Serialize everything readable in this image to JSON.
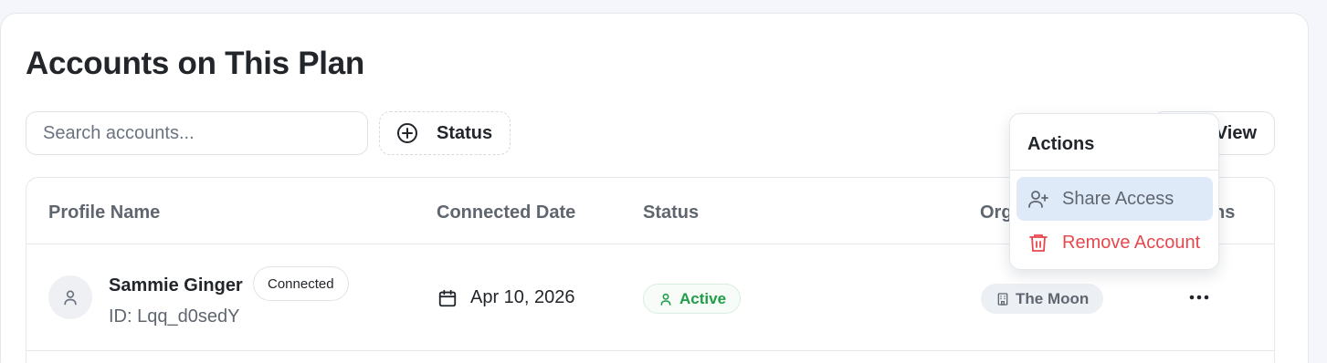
{
  "page": {
    "title": "Accounts on This Plan"
  },
  "toolbar": {
    "search_placeholder": "Search accounts...",
    "status_filter_label": "Status",
    "view_label": "View"
  },
  "table": {
    "columns": [
      "Profile Name",
      "Connected Date",
      "Status",
      "Organization",
      "Actions"
    ],
    "rows": [
      {
        "name": "Sammie Ginger",
        "id": "ID: Lqq_d0sedY",
        "connection_badge": "Connected",
        "connected_date": "Apr 10, 2026",
        "status": "Active",
        "organization": "The Moon"
      }
    ]
  },
  "actions_menu": {
    "title": "Actions",
    "items": [
      {
        "label": "Share Access",
        "icon": "user-plus-icon"
      },
      {
        "label": "Remove Account",
        "icon": "trash-icon"
      }
    ]
  },
  "colors": {
    "accent_highlight": "#dfeaf9",
    "status_active": "#1f9d47",
    "danger": "#e5484d"
  }
}
